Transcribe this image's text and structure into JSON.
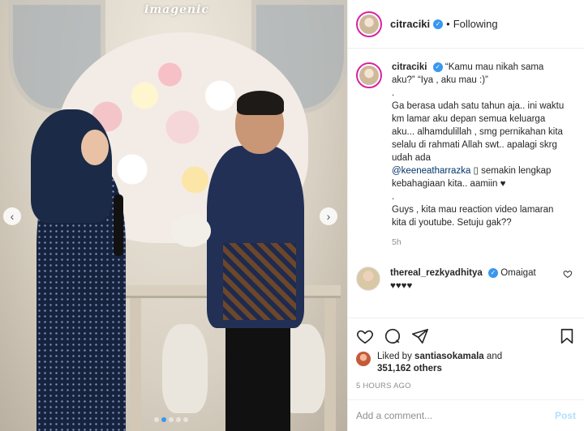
{
  "photo": {
    "watermark": "imagenic",
    "carousel": {
      "slide_count": 5,
      "active_index": 1
    }
  },
  "header": {
    "username": "citraciki",
    "separator": "•",
    "follow_status": "Following"
  },
  "caption": {
    "username": "citraciki",
    "lines": [
      "“Kamu mau nikah sama aku?” “Iya , aku mau :)”",
      ".",
      "Ga berasa udah satu tahun aja.. ini waktu km lamar aku depan semua keluarga aku... alhamdulillah , smg pernikahan kita selalu di rahmati Allah swt.. apalagi skrg udah ada",
      "semakin lengkap kebahagiaan kita.. aamiin ♥",
      ".",
      "Guys , kita mau reaction video lamaran kita di youtube. Setuju gak??"
    ],
    "mention": "@keeneatharrazka",
    "emoji_placeholder": "▯",
    "time": "5h"
  },
  "comment": {
    "username": "thereal_rezkyadhitya",
    "text": "Omaigat",
    "hearts": "♥♥♥♥"
  },
  "likes": {
    "prefix": "Liked by",
    "user": "santiasokamala",
    "conjunction": "and",
    "count": "351,162 others"
  },
  "posted_time": "5 HOURS AGO",
  "add_comment": {
    "placeholder": "Add a comment...",
    "post_label": "Post"
  },
  "colors": {
    "verified": "#3897f0",
    "story_ring": "#d6249f",
    "post_disabled": "#b2dffc",
    "muted": "#8e8e8e"
  }
}
